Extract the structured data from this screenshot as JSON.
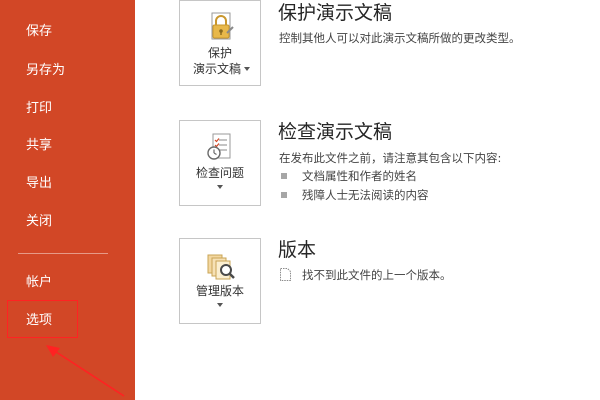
{
  "sidebar": {
    "items": [
      {
        "id": "save",
        "label": "保存"
      },
      {
        "id": "save-as",
        "label": "另存为"
      },
      {
        "id": "print",
        "label": "打印"
      },
      {
        "id": "share",
        "label": "共享"
      },
      {
        "id": "export",
        "label": "导出"
      },
      {
        "id": "close",
        "label": "关闭"
      },
      {
        "id": "account",
        "label": "帐户"
      },
      {
        "id": "options",
        "label": "选项"
      }
    ]
  },
  "sections": {
    "protect": {
      "tile_line1": "保护",
      "tile_line2": "演示文稿",
      "title": "保护演示文稿",
      "desc": "控制其他人可以对此演示文稿所做的更改类型。"
    },
    "inspect": {
      "tile_label": "检查问题",
      "title": "检查演示文稿",
      "desc": "在发布此文件之前，请注意其包含以下内容:",
      "bullets": [
        "文档属性和作者的姓名",
        "残障人士无法阅读的内容"
      ]
    },
    "versions": {
      "tile_label": "管理版本",
      "title": "版本",
      "desc": "找不到此文件的上一个版本。"
    }
  },
  "icons": {
    "protect": "lock-document-icon",
    "inspect": "inspect-checklist-icon",
    "versions": "versions-magnifier-icon",
    "version-row": "document-icon"
  },
  "colors": {
    "sidebar_bg": "#d24726",
    "annotation": "#ff2222",
    "lock": "#e8b84a"
  }
}
